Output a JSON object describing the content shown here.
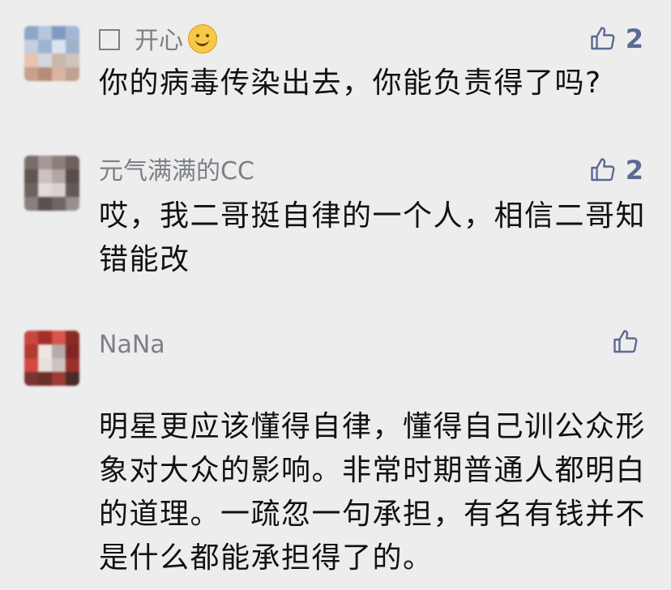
{
  "comments": [
    {
      "author": "开心",
      "likes": "2",
      "text": "你的病毒传染出去，你能负责得了吗?",
      "avatar_colors": [
        "#8fa6c9",
        "#b5c6dd",
        "#7f9bc4",
        "#a3b8d4",
        "#c3cfe0",
        "#9db3d2",
        "#dbe3ee",
        "#9fb2cc",
        "#e7c3b2",
        "#d6d8de",
        "#c9b7ad",
        "#d0c3bb",
        "#c8a08c",
        "#b78c7a",
        "#d9b4a2",
        "#bfa291"
      ]
    },
    {
      "author": "元气满满的CC",
      "likes": "2",
      "text": "哎，我二哥挺自律的一个人，相信二哥知错能改",
      "avatar_colors": [
        "#7a6c6a",
        "#a39894",
        "#8c7f7b",
        "#6e625f",
        "#5f5552",
        "#c9c2c0",
        "#b1a7a4",
        "#574c4a",
        "#6d6260",
        "#e0dcda",
        "#d7d1cf",
        "#63595a",
        "#8a7f7e",
        "#5a5051",
        "#6f6565",
        "#998f8e"
      ]
    },
    {
      "author": "NaNa",
      "likes": "",
      "text": "  明星更应该懂得自律，懂得自己训公众形象对大众的影响。非常时期普通人都明白的道理。一疏忽一句承担，有名有钱并不是什么都能承担得了的。",
      "avatar_colors": [
        "#c9463b",
        "#a3302a",
        "#d6564a",
        "#8c2923",
        "#b33a33",
        "#efe6e4",
        "#b5aaa8",
        "#7e2622",
        "#d24a40",
        "#e9e0de",
        "#cdc4c2",
        "#9b2f29",
        "#7a3532",
        "#6a2e2b",
        "#a03a33",
        "#4a2a28"
      ]
    }
  ]
}
